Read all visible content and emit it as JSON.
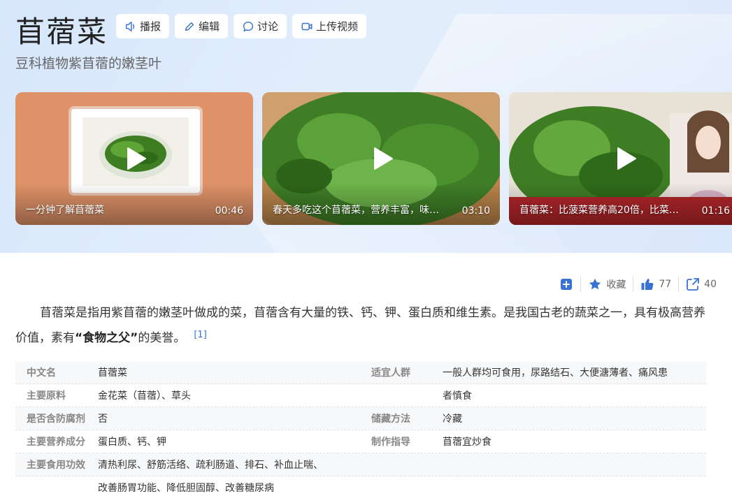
{
  "header": {
    "title": "苜蓿菜",
    "subtitle": "豆科植物紫苜蓿的嫩茎叶",
    "actions": [
      {
        "label": "播报",
        "icon": "speaker-icon"
      },
      {
        "label": "编辑",
        "icon": "pencil-icon"
      },
      {
        "label": "讨论",
        "icon": "chat-bubble-icon"
      },
      {
        "label": "上传视频",
        "icon": "video-camera-icon"
      }
    ]
  },
  "videos": [
    {
      "title": "一分钟了解苜蓿菜",
      "duration": "00:46"
    },
    {
      "title": "春天多吃这个苜蓿菜，营养丰富，味…",
      "duration": "03:10"
    },
    {
      "title": "苜蓿菜：比菠菜营养高20倍，比菜…",
      "duration": "01:16"
    }
  ],
  "toolbar": {
    "add_icon": "plus-square-icon",
    "collect_label": "收藏",
    "like_count": "77",
    "share_count": "40"
  },
  "summary": {
    "text1": "苜蓿菜是指用紫苜蓿的嫩茎叶做成的菜，苜蓿含有大量的铁、钙、钾、蛋白质和维生素。是我国古老的蔬菜之一，具有极高营养价值，素有",
    "bold": "“食物之父”",
    "text2": "的美誉。",
    "ref": "[1]"
  },
  "info": {
    "rows": [
      {
        "k1": "中文名",
        "v1": "苜蓿菜",
        "k2": "适宜人群",
        "v2": "一般人群均可食用，尿路结石、大便溏薄者、痛风患"
      },
      {
        "k1": "主要原料",
        "v1": "金花菜（苜蓿）、草头",
        "k2": "",
        "v2": "者慎食"
      },
      {
        "k1": "是否含防腐剂",
        "v1": "否",
        "k2": "储藏方法",
        "v2": "冷藏"
      },
      {
        "k1": "主要营养成分",
        "v1": "蛋白质、钙、钾",
        "k2": "制作指导",
        "v2": "苜蓿宜炒食"
      },
      {
        "k1": "主要食用功效",
        "v1": "清热利尿、舒筋活络、疏利肠道、排石、补血止喘、",
        "k2": "",
        "v2": ""
      },
      {
        "k1": "",
        "v1": "改善肠胃功能、降低胆固醇、改善糖尿病",
        "k2": "",
        "v2": ""
      }
    ]
  },
  "colors": {
    "accent": "#3872d4",
    "hero_bg": "#dce8fb"
  }
}
